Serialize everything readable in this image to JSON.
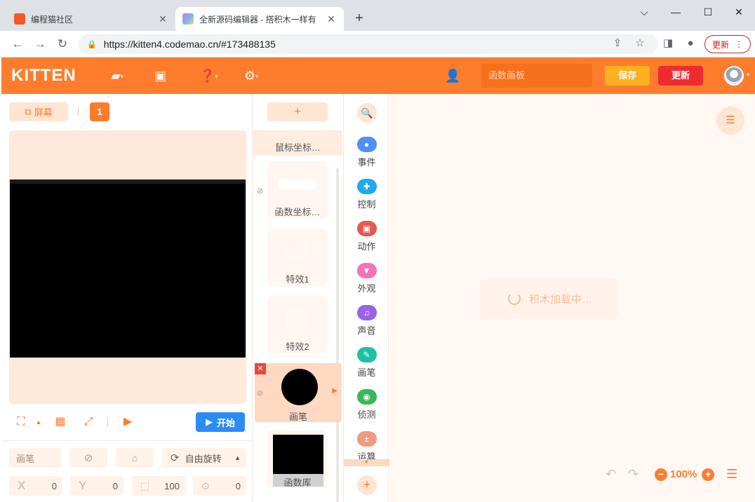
{
  "browser": {
    "tabs": [
      {
        "title": "编程猫社区",
        "active": false
      },
      {
        "title": "全新源码编辑器 - 搭积木一样有",
        "active": true
      }
    ],
    "new_tab": "+",
    "window_controls": {
      "minimize": "—",
      "maximize": "☐",
      "close": "✕",
      "tab_search": "⌵"
    },
    "url": "https://kitten4.codemao.cn/#173488135",
    "update_button": "更新"
  },
  "app": {
    "logo": "KITTEN",
    "project_name": "函数画板",
    "save_label": "保存",
    "update_label": "更新",
    "accent": "#fe7d2d"
  },
  "stage": {
    "screen_label": "屏幕",
    "screen_number": "1",
    "start_label": "开始"
  },
  "properties": {
    "sprite_name": "画笔",
    "rotation_mode": "自由旋转",
    "x_label": "X",
    "x_value": "0",
    "y_label": "Y",
    "y_value": "0",
    "scale_value": "100",
    "direction_value": "0"
  },
  "sprites": {
    "add_label": "+",
    "items": [
      {
        "name": "鼠标坐标…"
      },
      {
        "name": "函数坐标…"
      },
      {
        "name": "特效1"
      },
      {
        "name": "特效2"
      },
      {
        "name": "画笔",
        "selected": true
      },
      {
        "name": "函数库"
      }
    ]
  },
  "categories": [
    {
      "label": "事件",
      "color": "#4f8ff7"
    },
    {
      "label": "控制",
      "color": "#20a9f0"
    },
    {
      "label": "动作",
      "color": "#e35a52"
    },
    {
      "label": "外观",
      "color": "#f074b7"
    },
    {
      "label": "声音",
      "color": "#9a62e5"
    },
    {
      "label": "画笔",
      "color": "#1ec2a3"
    },
    {
      "label": "侦测",
      "color": "#3cb55b"
    },
    {
      "label": "运算",
      "color": "#f09a7f"
    }
  ],
  "workspace": {
    "loading_text": "积木加载中…",
    "zoom": "100%"
  }
}
